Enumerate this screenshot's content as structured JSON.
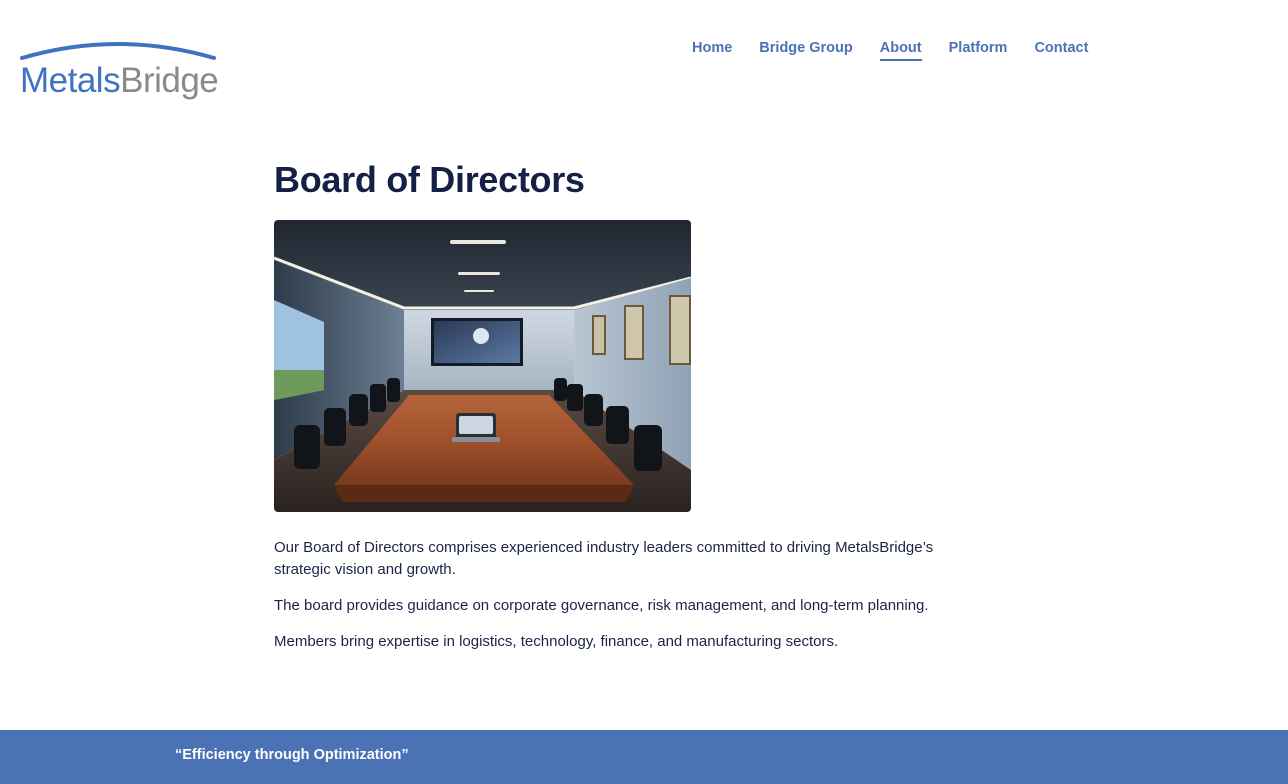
{
  "brand": {
    "logo_text_part1": "Metals",
    "logo_text_part2": "Bridge",
    "logo_color_primary": "#3f73c0",
    "logo_color_secondary": "#8a8a8a"
  },
  "nav": {
    "items": [
      {
        "label": "Home",
        "active": false
      },
      {
        "label": "Bridge Group",
        "active": false
      },
      {
        "label": "About",
        "active": true
      },
      {
        "label": "Platform",
        "active": false
      },
      {
        "label": "Contact",
        "active": false
      }
    ],
    "color": "#4a72b5"
  },
  "main": {
    "title": "Board of Directors",
    "hero_image_icon": "boardroom-image",
    "paragraphs": [
      "Our Board of Directors comprises experienced industry leaders committed to driving MetalsBridge’s strategic vision and growth.",
      "The board provides guidance on corporate governance, risk management, and long-term planning.",
      "Members bring expertise in logistics, technology, finance, and manufacturing sectors."
    ]
  },
  "footer": {
    "quote": "“Efficiency through Optimization”",
    "background": "#4a72b5"
  }
}
